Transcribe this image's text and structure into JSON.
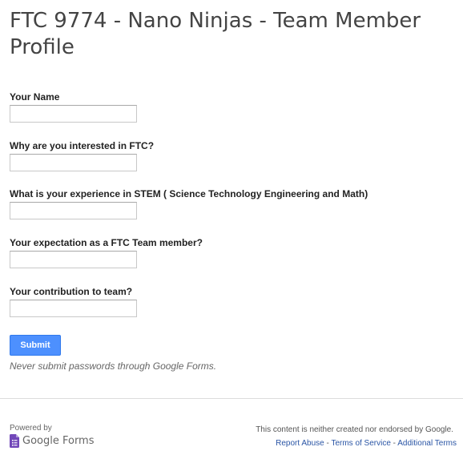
{
  "form": {
    "title": "FTC 9774 - Nano Ninjas - Team Member Profile",
    "questions": [
      {
        "label": "Your Name",
        "value": ""
      },
      {
        "label": "Why are you interested in FTC?",
        "value": ""
      },
      {
        "label": "What is your experience in STEM ( Science Technology Engineering and Math)",
        "value": ""
      },
      {
        "label": "Your expectation as a FTC Team member?",
        "value": ""
      },
      {
        "label": "Your contribution to team?",
        "value": ""
      }
    ],
    "submit_label": "Submit",
    "password_warning": "Never submit passwords through Google Forms."
  },
  "footer": {
    "powered_by": "Powered by",
    "logo_text": "Google Forms",
    "disclaimer": "This content is neither created nor endorsed by Google.",
    "links": {
      "report_abuse": "Report Abuse",
      "separator": " - ",
      "terms": "Terms of Service",
      "additional_terms": "Additional Terms"
    }
  },
  "colors": {
    "accent": "#4d90fe",
    "link": "#2a55a5",
    "forms_brand": "#7248b9"
  },
  "icons": {
    "forms_logo": "google-forms-icon"
  }
}
